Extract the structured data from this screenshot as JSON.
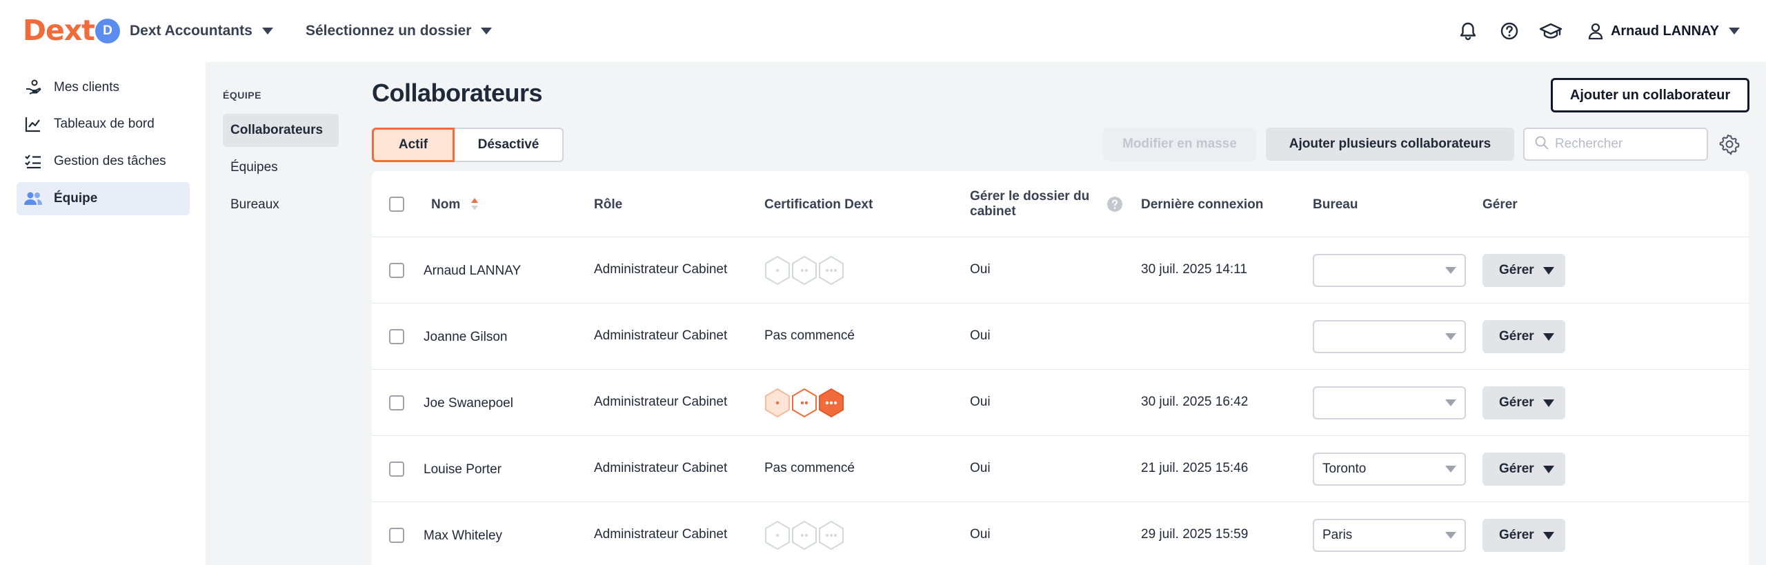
{
  "topbar": {
    "logo": "Dext",
    "org_initial": "D",
    "org_name": "Dext Accountants",
    "folder_label": "Sélectionnez un dossier",
    "user_name": "Arnaud LANNAY",
    "icons": [
      "bell-icon",
      "help-icon",
      "graduation-cap-icon",
      "user-icon"
    ]
  },
  "sidebar": {
    "items": [
      {
        "label": "Mes clients",
        "icon": "hand-coins-icon"
      },
      {
        "label": "Tableaux de bord",
        "icon": "chart-line-icon"
      },
      {
        "label": "Gestion des tâches",
        "icon": "checklist-icon"
      },
      {
        "label": "Équipe",
        "icon": "team-icon"
      }
    ]
  },
  "subnav": {
    "heading": "ÉQUIPE",
    "items": [
      "Collaborateurs",
      "Équipes",
      "Bureaux"
    ]
  },
  "main": {
    "title": "Collaborateurs",
    "add_button": "Ajouter un collaborateur",
    "tabs": [
      "Actif",
      "Désactivé"
    ],
    "mass_edit": "Modifier en masse",
    "add_multiple": "Ajouter plusieurs collaborateurs",
    "search_placeholder": "Rechercher"
  },
  "table": {
    "headers": {
      "name": "Nom",
      "role": "Rôle",
      "cert": "Certification Dext",
      "manage_folder": "Gérer le dossier du cabinet",
      "last_login": "Dernière connexion",
      "office": "Bureau",
      "manage": "Gérer"
    },
    "rows": [
      {
        "name": "Arnaud LANNAY",
        "role": "Administrateur Cabinet",
        "cert_text": "",
        "cert_level": 0,
        "manage_folder": "Oui",
        "last_login": "30 juil. 2025 14:11",
        "office": "",
        "manage": "Gérer"
      },
      {
        "name": "Joanne Gilson",
        "role": "Administrateur Cabinet",
        "cert_text": "Pas commencé",
        "cert_level": null,
        "manage_folder": "Oui",
        "last_login": "",
        "office": "",
        "manage": "Gérer"
      },
      {
        "name": "Joe Swanepoel",
        "role": "Administrateur Cabinet",
        "cert_text": "",
        "cert_level": 3,
        "manage_folder": "Oui",
        "last_login": "30 juil. 2025 16:42",
        "office": "",
        "manage": "Gérer"
      },
      {
        "name": "Louise Porter",
        "role": "Administrateur Cabinet",
        "cert_text": "Pas commencé",
        "cert_level": null,
        "manage_folder": "Oui",
        "last_login": "21 juil. 2025 15:46",
        "office": "Toronto",
        "manage": "Gérer"
      },
      {
        "name": "Max Whiteley",
        "role": "Administrateur Cabinet",
        "cert_text": "",
        "cert_level": 0,
        "manage_folder": "Oui",
        "last_login": "29 juil. 2025 15:59",
        "office": "Paris",
        "manage": "Gérer"
      }
    ]
  },
  "colors": {
    "accent": "#f26b3a",
    "avatar": "#5b8def",
    "active_nav": "#e8edf8"
  }
}
